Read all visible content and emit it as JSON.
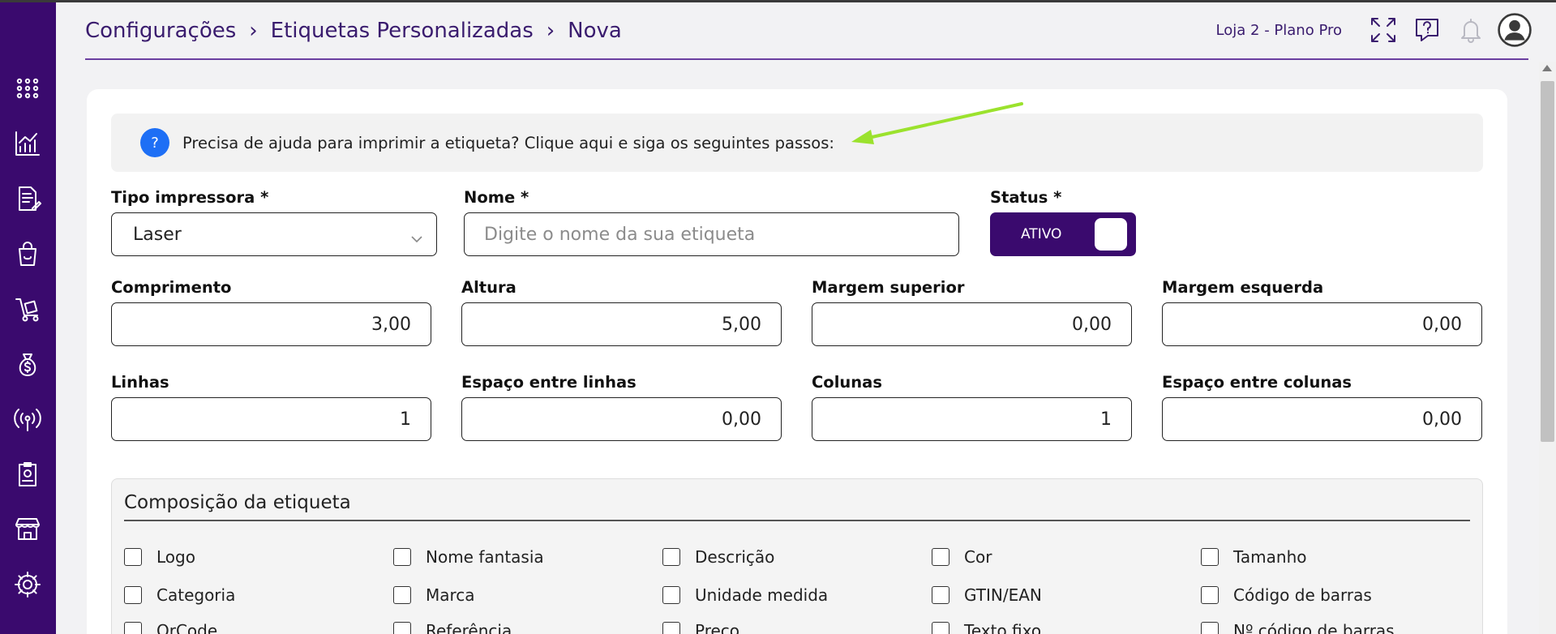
{
  "breadcrumb": [
    "Configurações",
    "Etiquetas Personalizadas",
    "Nova"
  ],
  "header": {
    "store": "Loja 2 - Plano Pro"
  },
  "help": {
    "text": "Precisa de ajuda para imprimir a etiqueta? Clique aqui e siga os seguintes passos:",
    "icon": "?"
  },
  "form": {
    "tipo_impressora": {
      "label": "Tipo impressora *",
      "value": "Laser"
    },
    "nome": {
      "label": "Nome *",
      "placeholder": "Digite o nome da sua etiqueta"
    },
    "status": {
      "label": "Status *",
      "value": "ATIVO"
    },
    "comprimento": {
      "label": "Comprimento",
      "value": "3,00"
    },
    "altura": {
      "label": "Altura",
      "value": "5,00"
    },
    "margem_superior": {
      "label": "Margem superior",
      "value": "0,00"
    },
    "margem_esquerda": {
      "label": "Margem esquerda",
      "value": "0,00"
    },
    "linhas": {
      "label": "Linhas",
      "value": "1"
    },
    "espaco_linhas": {
      "label": "Espaço entre linhas",
      "value": "0,00"
    },
    "colunas": {
      "label": "Colunas",
      "value": "1"
    },
    "espaco_colunas": {
      "label": "Espaço entre colunas",
      "value": "0,00"
    }
  },
  "composicao": {
    "title": "Composição da etiqueta",
    "items": [
      "Logo",
      "Nome fantasia",
      "Descrição",
      "Cor",
      "Tamanho",
      "Categoria",
      "Marca",
      "Unidade medida",
      "GTIN/EAN",
      "Código de barras",
      "QrCode",
      "Referência",
      "Preço",
      "Texto fixo",
      "Nº código de barras"
    ]
  },
  "colors": {
    "sidebar": "#3a0a6e",
    "accent": "#3a1c6e",
    "help_icon": "#1e6ff5",
    "arrow": "#9be22d"
  }
}
